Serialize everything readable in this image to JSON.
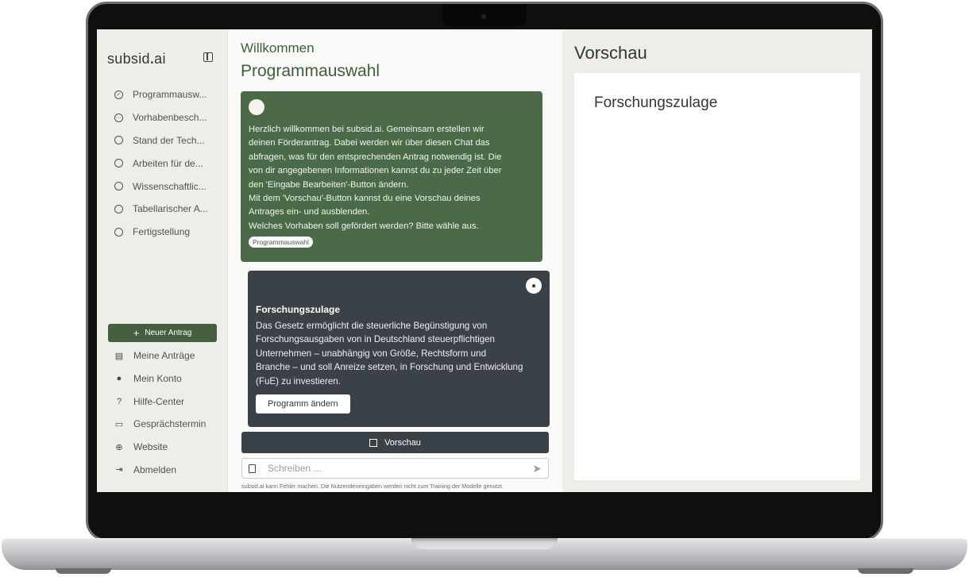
{
  "sidebar": {
    "brand": {
      "name": "subsid",
      "dot": ".",
      "suffix": "ai"
    },
    "steps": [
      {
        "label": "Programmausw...",
        "state": "done"
      },
      {
        "label": "Vorhabenbesch...",
        "state": "in-progress"
      },
      {
        "label": "Stand der Tech...",
        "state": "open"
      },
      {
        "label": "Arbeiten für de...",
        "state": "open"
      },
      {
        "label": "Wissenschaftlic...",
        "state": "open"
      },
      {
        "label": "Tabellarischer A...",
        "state": "open"
      },
      {
        "label": "Fertigstellung",
        "state": "open"
      }
    ],
    "new_button": "Neuer Antrag",
    "nav": [
      {
        "label": "Meine Anträge",
        "icon": "clipboard-icon"
      },
      {
        "label": "Mein Konto",
        "icon": "user-icon"
      },
      {
        "label": "Hilfe-Center",
        "icon": "question-icon"
      },
      {
        "label": "Gesprächstermin",
        "icon": "chat-bubbles-icon"
      },
      {
        "label": "Website",
        "icon": "globe-icon"
      },
      {
        "label": "Abmelden",
        "icon": "logout-icon"
      }
    ]
  },
  "chat": {
    "welcome": "Willkommen",
    "section_title": "Programmauswahl",
    "bot_message": {
      "lines": [
        "Herzlich willkommen bei subsid.ai. Gemeinsam erstellen wir",
        "deinen Förderantrag. Dabei werden wir über diesen Chat das",
        "abfragen, was für den entsprechenden Antrag notwendig ist. Die",
        "von dir angegebenen Informationen kannst du zu jeder Zeit über",
        "den 'Eingabe Bearbeiten'-Button ändern.",
        "Mit dem 'Vorschau'-Button kannst du eine Vorschau deines",
        "Antrages ein- und ausblenden.",
        "Welches Vorhaben soll gefördert werden? Bitte wähle aus."
      ],
      "chip": "Programmauswahl"
    },
    "user_message": {
      "title": "Forschungszulage",
      "lines": [
        "Das Gesetz ermöglicht die steuerliche Begünstigung von",
        "Forschungsausgaben von in Deutschland steuerpflichtigen",
        "Unternehmen – unabhängig von Größe, Rechtsform und",
        "Branche – und soll Anreize setzen, in Forschung und Entwicklung",
        "(FuE) zu investieren."
      ],
      "button": "Programm ändern"
    },
    "preview_button": "Vorschau",
    "input": {
      "value": "",
      "placeholder": "Schreiben ..."
    },
    "disclaimer": "subsid.ai kann Fehler machen. Die Nutzendeneingaben werden nicht zum Training der Modelle genutzt."
  },
  "preview": {
    "title": "Vorschau",
    "document_heading": "Forschungszulage"
  },
  "colors": {
    "primary_green": "#44603f",
    "bot_bubble": "#4b6a48",
    "user_bubble": "#3a4248",
    "background": "#f3f1ec"
  }
}
